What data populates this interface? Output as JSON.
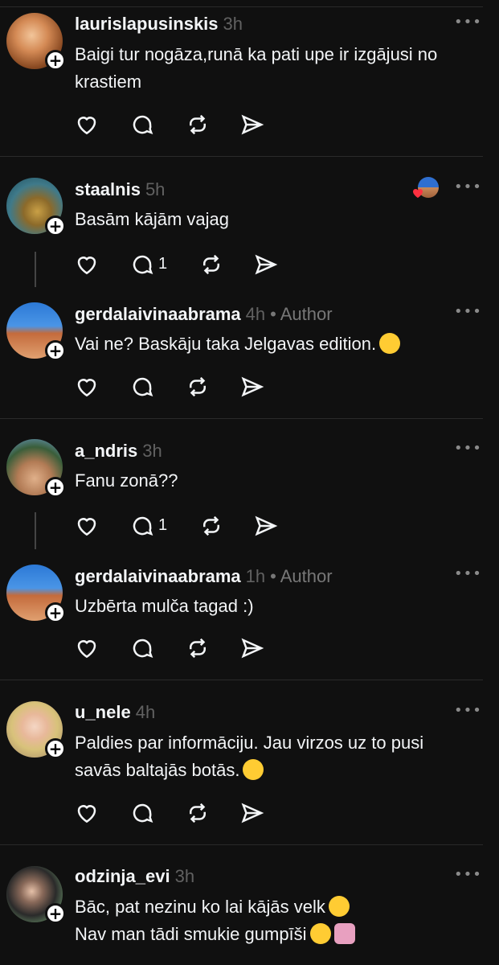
{
  "colors": {
    "background": "#101010",
    "text": "#f3f5f7",
    "muted": "#616161",
    "like_red": "#ff3040"
  },
  "icons": {
    "like": "heart-icon",
    "reply": "comment-bubble-icon",
    "repost": "repost-icon",
    "share": "send-icon",
    "more": "more-options-icon",
    "follow": "plus-icon"
  },
  "posts": [
    {
      "username": "laurislapusinskis",
      "time": "3h",
      "author": "",
      "lines": [
        "Baigi tur nogāza,runā ka pati upe ir izgājusi no",
        "krastiem"
      ],
      "reply_count": ""
    },
    {
      "username": "staalnis",
      "time": "5h",
      "author": "",
      "lines": [
        "Basām kājām vajag"
      ],
      "reply_count": "1"
    },
    {
      "username": "gerdalaivinaabrama",
      "time": "4h",
      "author": "• Author",
      "lines": [
        "Vai ne? Baskāju taka Jelgavas edition."
      ],
      "reply_count": ""
    },
    {
      "username": "a_ndris",
      "time": "3h",
      "author": "",
      "lines": [
        "Fanu zonā??"
      ],
      "reply_count": "1"
    },
    {
      "username": "gerdalaivinaabrama",
      "time": "1h",
      "author": "• Author",
      "lines": [
        "Uzbērta mulča tagad :)"
      ],
      "reply_count": ""
    },
    {
      "username": "u_nele",
      "time": "4h",
      "author": "",
      "lines": [
        "Paldies par informāciju. Jau virzos uz to pusi",
        "savās baltajās botās."
      ],
      "reply_count": ""
    },
    {
      "username": "odzinja_evi",
      "time": "3h",
      "author": "",
      "lines": [
        "Bāc, pat nezinu ko lai kājās velk",
        "Nav man tādi smukie gumpīši"
      ],
      "reply_count": ""
    }
  ],
  "more_glyph": "•••",
  "plus_glyph": "+"
}
